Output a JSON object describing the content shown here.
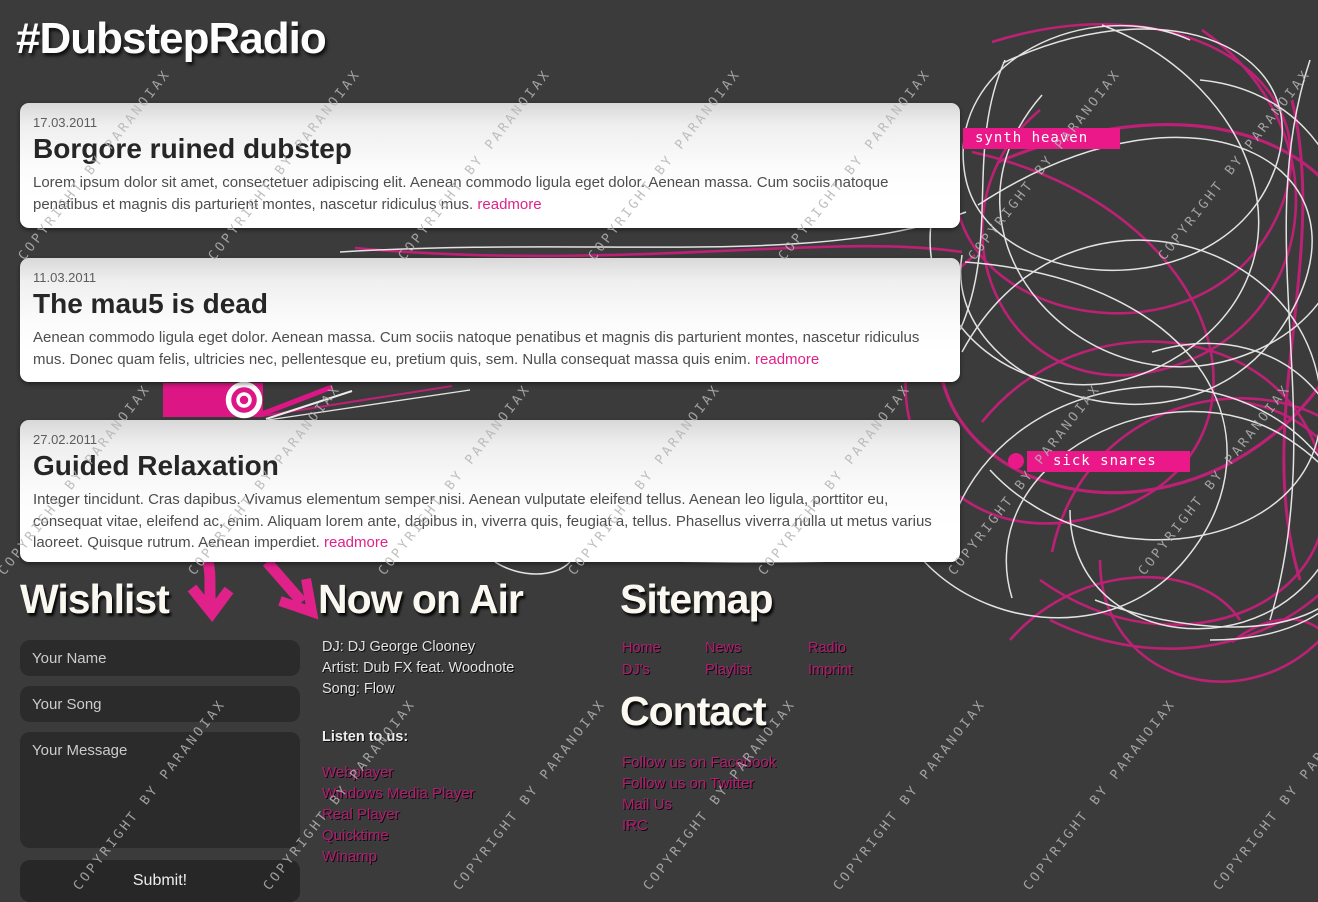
{
  "page": {
    "title": "#DubstepRadio",
    "watermark": "COPYRIGHT BY PARANOIAX"
  },
  "colors": {
    "background": "#3b3b3b",
    "accent_pink": "#e0218a",
    "label_pink": "#ea1889",
    "link_pink": "#b21d70",
    "squiggle_pink": "#c32079"
  },
  "tags": {
    "synth": "synth heaven",
    "snares": "sick snares"
  },
  "news": [
    {
      "date": "17.03.2011",
      "title": "Borgore ruined dubstep",
      "body": "Lorem ipsum dolor sit amet, consectetuer adipiscing elit. Aenean commodo ligula eget dolor. Aenean massa. Cum sociis natoque penatibus et magnis dis parturient montes, nascetur ridiculus mus.",
      "readmore": "readmore"
    },
    {
      "date": "11.03.2011",
      "title": "The mau5 is dead",
      "body": "Aenean commodo ligula eget dolor. Aenean massa. Cum sociis natoque penatibus et magnis dis parturient montes, nascetur ridiculus mus. Donec quam felis, ultricies nec, pellentesque eu, pretium quis, sem. Nulla consequat massa quis enim.",
      "readmore": "readmore"
    },
    {
      "date": "27.02.2011",
      "title": "Guided Relaxation",
      "body": "Integer tincidunt. Cras dapibus. Vivamus elementum semper nisi. Aenean vulputate eleifend tellus. Aenean leo ligula, porttitor eu, consequat vitae, eleifend ac, enim. Aliquam lorem ante, dapibus in, viverra quis, feugiat a, tellus. Phasellus viverra nulla ut metus varius laoreet. Quisque rutrum. Aenean imperdiet.",
      "readmore": "readmore"
    }
  ],
  "wishlist": {
    "heading": "Wishlist",
    "name_placeholder": "Your Name",
    "song_placeholder": "Your Song",
    "message_placeholder": "Your Message",
    "submit_label": "Submit!"
  },
  "now_on_air": {
    "heading": "Now on Air",
    "dj": "DJ: DJ George Clooney",
    "artist": "Artist: Dub FX feat. Woodnote",
    "song": "Song: Flow",
    "listen_label": "Listen to us:",
    "players": [
      "Webplayer",
      "Windows Media Player",
      "Real Player",
      "Quicktime",
      "Winamp"
    ]
  },
  "sitemap": {
    "heading": "Sitemap",
    "links": [
      "Home",
      "News",
      "Radio",
      "DJ's",
      "Playlist",
      "Imprint"
    ]
  },
  "contact": {
    "heading": "Contact",
    "links": [
      "Follow us on Facebook",
      "Follow us on Twitter",
      "Mail Us",
      "IRC"
    ]
  }
}
